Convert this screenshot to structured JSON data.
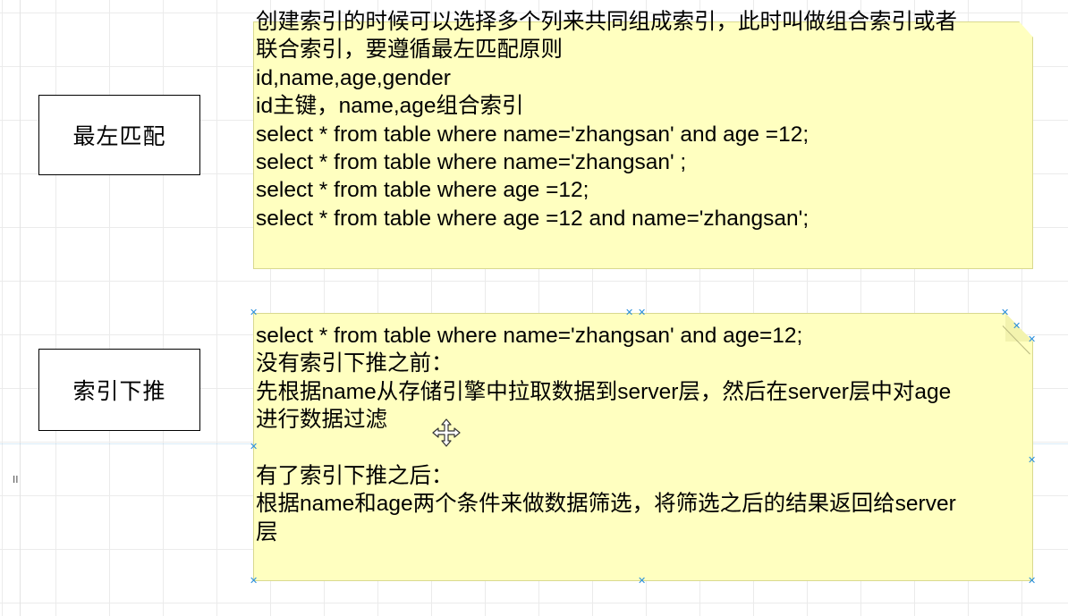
{
  "concepts": {
    "leftmost_match": "最左匹配",
    "index_pushdown": "索引下推"
  },
  "notes": {
    "composite_index": {
      "lines": [
        "创建索引的时候可以选择多个列来共同组成索引，此时叫做组合索引或者",
        "联合索引，要遵循最左匹配原则",
        "id,name,age,gender",
        "id主键，name,age组合索引",
        "select * from table where name='zhangsan' and age =12;",
        "select * from table where name='zhangsan' ;",
        "select * from table where age =12;",
        "select * from table where age =12 and name='zhangsan';"
      ]
    },
    "index_condition_pushdown": {
      "lines": [
        "select * from table where name='zhangsan' and age=12;",
        "没有索引下推之前：",
        "先根据name从存储引擎中拉取数据到server层，然后在server层中对age",
        "进行数据过滤",
        "",
        "有了索引下推之后：",
        "根据name和age两个条件来做数据筛选，将筛选之后的结果返回给server",
        "层"
      ]
    }
  },
  "colors": {
    "note_fill": "#ffffc0",
    "selection_handle": "#2a8fdc",
    "grid": "#ebebeb"
  },
  "icons": {
    "selection_handle": "x-handle-icon",
    "cursor": "move-cursor-icon"
  },
  "left_marker": "II"
}
